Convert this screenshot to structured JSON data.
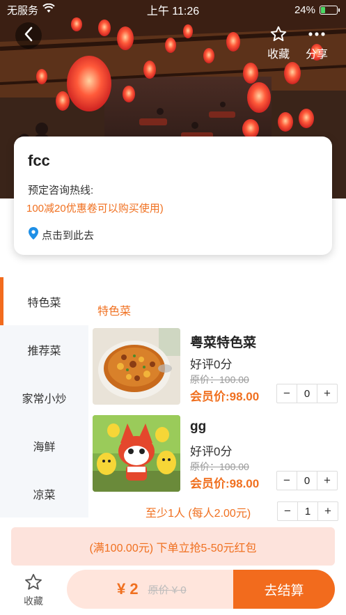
{
  "status_bar": {
    "carrier": "无服务",
    "time": "上午 11:26",
    "battery": "24%",
    "battery_level": 0.24
  },
  "header": {
    "favorite_label": "收藏",
    "share_label": "分享"
  },
  "shop": {
    "name": "fcc",
    "hotline_label": "预定咨询热线:",
    "promo_text": "100减20优惠卷可以购买使用)",
    "location_text": "点击到此去"
  },
  "categories": [
    {
      "label": "特色菜",
      "active": true
    },
    {
      "label": "推荐菜",
      "active": false
    },
    {
      "label": "家常小炒",
      "active": false
    },
    {
      "label": "海鲜",
      "active": false
    },
    {
      "label": "凉菜",
      "active": false
    }
  ],
  "section_title": "特色菜",
  "dishes": [
    {
      "name": "粤菜特色菜",
      "rating": "好评0分",
      "original_price": "原价：100.00",
      "member_price": "会员价:98.00",
      "qty": "0",
      "minus": "−",
      "plus": "+"
    },
    {
      "name": "gg",
      "rating": "好评0分",
      "original_price": "原价：100.00",
      "member_price": "会员价:98.00",
      "qty": "0",
      "minus": "−",
      "plus": "+"
    }
  ],
  "people": {
    "label": "至少1人 (每人2.00元)",
    "qty": "1",
    "minus": "−",
    "plus": "+"
  },
  "banner_text": "(满100.00元) 下单立抢5-50元红包",
  "bottom": {
    "favorite_label": "收藏",
    "total": "¥ 2",
    "original_total": "原价 ¥ 0",
    "checkout_label": "去结算"
  },
  "colors": {
    "accent": "#f26b1d",
    "accent_text": "#f07020",
    "banner_bg": "#fde3dc",
    "cart_bg": "#ffe5dc",
    "location_pin": "#1e8fe6"
  },
  "icons": [
    "wifi-icon",
    "battery-icon",
    "back-arrow-icon",
    "star-icon",
    "more-dots-icon",
    "location-pin-icon"
  ]
}
